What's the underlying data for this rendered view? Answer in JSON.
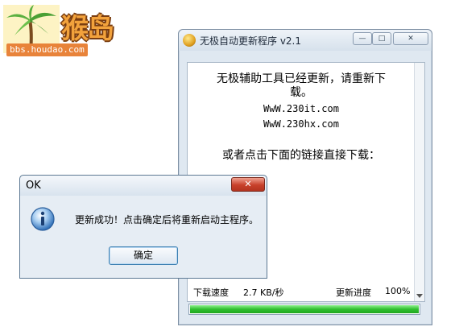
{
  "watermark": {
    "brand": "猴岛",
    "url": "bbs.houdao.com"
  },
  "updater": {
    "title": "无极自动更新程序 v2.1",
    "message_line1": "无极辅助工具已经更新，请重新下",
    "message_line2": "载。",
    "site1": "WwW.230it.com",
    "site2": "WwW.230hx.com",
    "message2": "或者点击下面的链接直接下载：",
    "download_speed_label": "下载速度",
    "download_speed_value": "2.7 KB/秒",
    "progress_label": "更新进度",
    "progress_value": "100%",
    "progress_fraction": 1.0
  },
  "dialog": {
    "title": "OK",
    "message": "更新成功！点击确定后将重新启动主程序。",
    "ok_label": "确定",
    "close_glyph": "✕",
    "icon": "info-icon"
  },
  "colors": {
    "progress_green": "#2fbf2f",
    "close_red": "#c8402a",
    "brand_orange": "#f2a23c"
  }
}
